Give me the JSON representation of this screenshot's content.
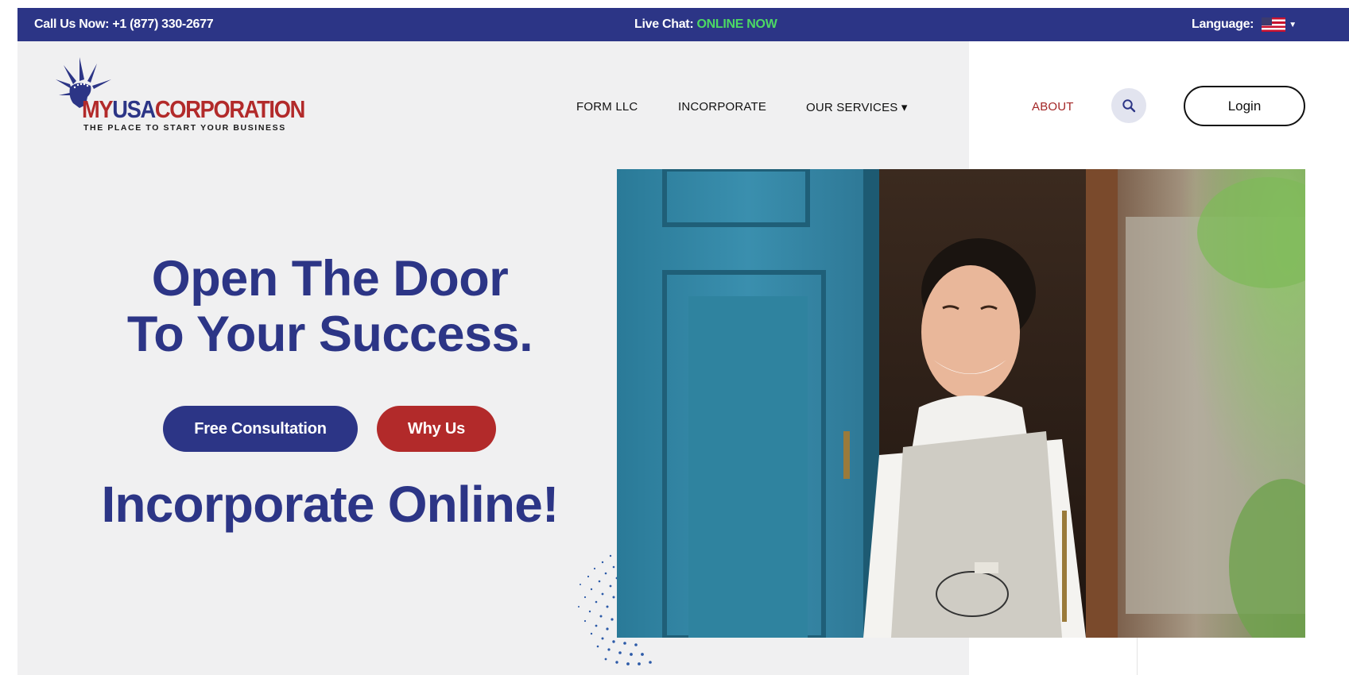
{
  "topbar": {
    "phone": "Call Us Now: +1 (877) 330-2677",
    "chat_label": "Live Chat: ",
    "chat_status": "ONLINE NOW",
    "language_label": "Language:",
    "flag_icon": "us-flag-icon"
  },
  "logo": {
    "my": "MY",
    "usa": "USA",
    "corp": "CORPORATION",
    "tagline": "THE PLACE TO START YOUR BUSINESS"
  },
  "nav": {
    "form_llc": "FORM LLC",
    "incorporate": "INCORPORATE",
    "our_services": "OUR SERVICES ▾",
    "about": "ABOUT",
    "login": "Login"
  },
  "hero": {
    "title_line1": "Open The Door",
    "title_line2": "To Your Success.",
    "btn_free": "Free Consultation",
    "btn_why": "Why Us",
    "subtitle": "Incorporate Online!"
  },
  "colors": {
    "brand_blue": "#2c3586",
    "brand_red": "#b22a2a",
    "online_green": "#4cd964"
  }
}
